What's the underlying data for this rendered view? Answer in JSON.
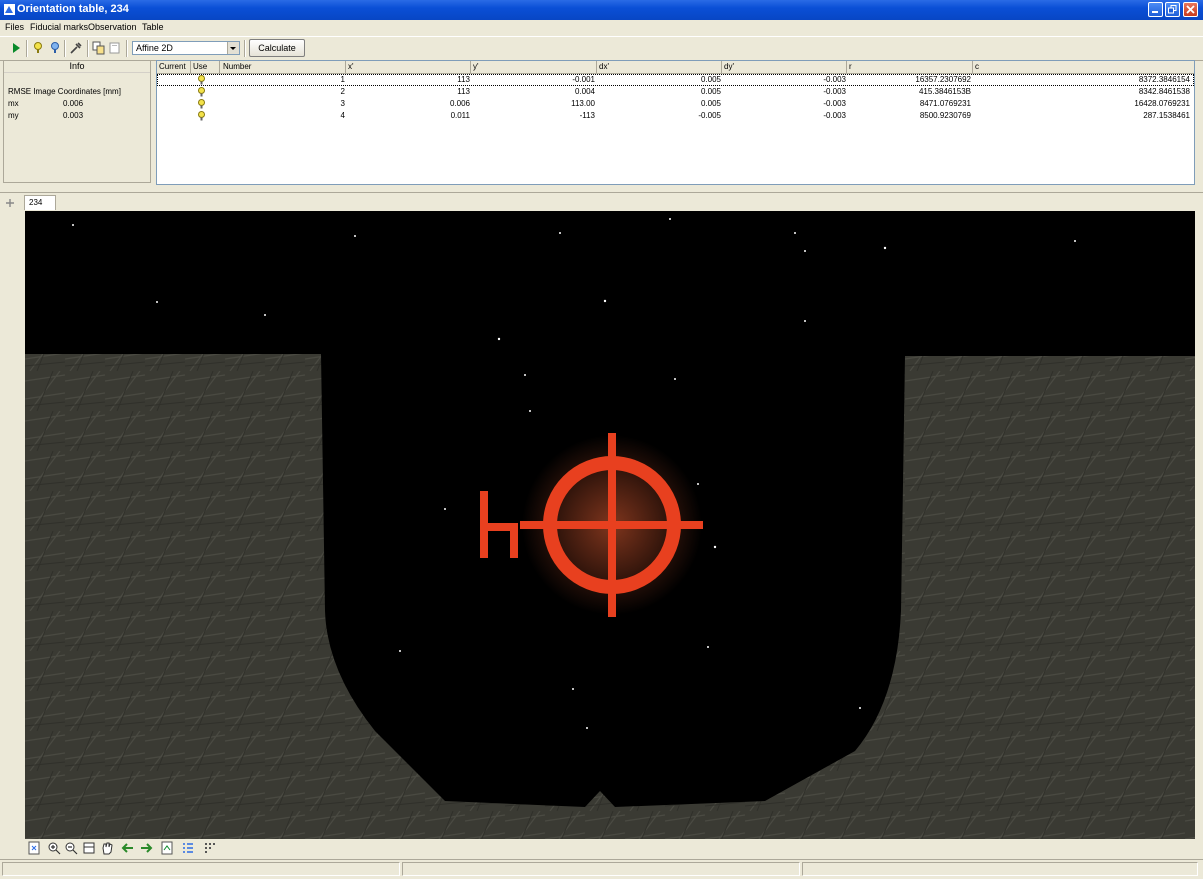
{
  "window": {
    "title": "Orientation table, 234",
    "app_icon": "orientation-icon",
    "controls": [
      "minimize-icon",
      "restore-icon",
      "close-icon"
    ]
  },
  "menubar": {
    "items": [
      "Files",
      "Fiducial marks",
      "Observation",
      "Table"
    ]
  },
  "toolbar": {
    "icons": [
      "play-icon",
      "fiducial-marker-icon",
      "marker-alt-icon",
      "tool-icon",
      "copy-icon",
      "paste-icon"
    ],
    "transform_select_value": "Affine  2D",
    "calculate_label": "Calculate"
  },
  "info_panel": {
    "header": "Info",
    "rmse_label": "RMSE Image Coordinates [mm]",
    "rows": [
      {
        "label": "mx",
        "value": "0.006"
      },
      {
        "label": "my",
        "value": "0.003"
      }
    ]
  },
  "table": {
    "columns": [
      "Current",
      "Use",
      "Number",
      "x'",
      "y'",
      "dx'",
      "dy'",
      "r",
      "c"
    ],
    "rows": [
      {
        "number": "1",
        "x": "113",
        "y": "-0.001",
        "dx": "0.005",
        "dy": "-0.003",
        "r": "16357.2307692",
        "c": "8372.3846154"
      },
      {
        "number": "2",
        "x": "113",
        "y": "0.004",
        "dx": "0.005",
        "dy": "-0.003",
        "r": "415.3846153B",
        "c": "8342.8461538"
      },
      {
        "number": "3",
        "x": "0.006",
        "y": "113.00",
        "dx": "0.005",
        "dy": "-0.003",
        "r": "8471.0769231",
        "c": "16428.0769231"
      },
      {
        "number": "4",
        "x": "0.011",
        "y": "-113",
        "dx": "-0.005",
        "dy": "-0.003",
        "r": "8500.9230769",
        "c": "287.1538461"
      }
    ]
  },
  "image_tab": {
    "label": "234"
  },
  "viewer": {
    "content": "fiducial-mark-image",
    "mark_color": "#e8401f"
  },
  "bottom_toolbar": {
    "icons": [
      "fit-icon",
      "zoom-in-icon",
      "zoom-out-icon",
      "zoom-box-icon",
      "pan-hand-icon",
      "arrow-left-icon",
      "arrow-right-icon",
      "export-icon",
      "list-icon",
      "grid-icon"
    ]
  }
}
